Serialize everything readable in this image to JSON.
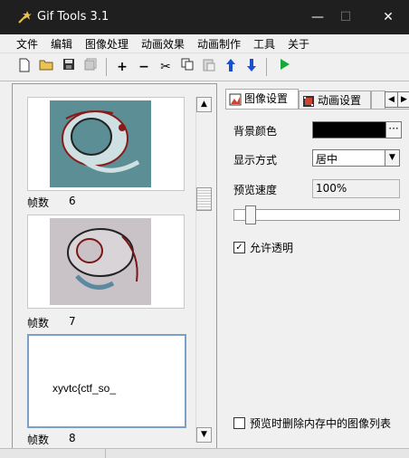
{
  "window": {
    "title": "Gif Tools 3.1",
    "minimize": "—",
    "maximize": "☐",
    "close": "✕"
  },
  "menu": [
    "文件",
    "编辑",
    "图像处理",
    "动画效果",
    "动画制作",
    "工具",
    "关于"
  ],
  "frames": [
    {
      "label": "帧数",
      "number": "6"
    },
    {
      "label": "帧数",
      "number": "7"
    },
    {
      "label": "帧数",
      "number": "8",
      "text": "xyvtc{ctf_so_"
    }
  ],
  "tabs": [
    "图像设置",
    "动画设置"
  ],
  "settings": {
    "background_color_label": "背景颜色",
    "background_color": "#000000",
    "ellipsis": "···",
    "display_mode_label": "显示方式",
    "display_mode_value": "居中",
    "preview_speed_label": "预览速度",
    "preview_speed_value": "100%",
    "allow_transparency_label": "允许透明",
    "allow_transparency_checked": true,
    "delete_images_label": "预览时删除内存中的图像列表",
    "delete_images_checked": false
  }
}
